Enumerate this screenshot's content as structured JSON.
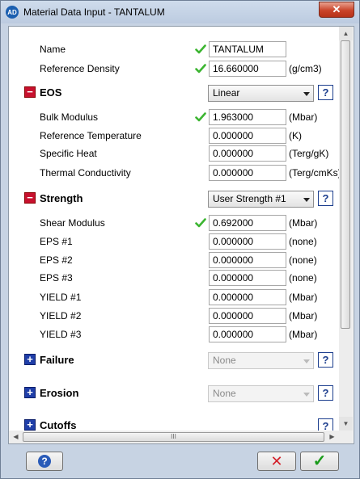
{
  "window": {
    "title": "Material Data Input - TANTALUM",
    "app_icon": "AD",
    "close_glyph": "✕"
  },
  "general": {
    "name_label": "Name",
    "name_value": "TANTALUM",
    "density_label": "Reference Density",
    "density_value": "16.660000",
    "density_unit": "(g/cm3)"
  },
  "eos": {
    "title": "EOS",
    "toggle": "−",
    "model": "Linear",
    "help": "?",
    "rows": [
      {
        "label": "Bulk Modulus",
        "value": "1.963000",
        "unit": "(Mbar)"
      },
      {
        "label": "Reference Temperature",
        "value": "0.000000",
        "unit": "(K)"
      },
      {
        "label": "Specific Heat",
        "value": "0.000000",
        "unit": "(Terg/gK)"
      },
      {
        "label": "Thermal Conductivity",
        "value": "0.000000",
        "unit": "(Terg/cmKs)"
      }
    ]
  },
  "strength": {
    "title": "Strength",
    "toggle": "−",
    "model": "User Strength #1",
    "help": "?",
    "rows": [
      {
        "label": "Shear Modulus",
        "value": "0.692000",
        "unit": "(Mbar)"
      },
      {
        "label": "EPS #1",
        "value": "0.000000",
        "unit": "(none)"
      },
      {
        "label": "EPS #2",
        "value": "0.000000",
        "unit": "(none)"
      },
      {
        "label": "EPS #3",
        "value": "0.000000",
        "unit": "(none)"
      },
      {
        "label": "YIELD #1",
        "value": "0.000000",
        "unit": "(Mbar)"
      },
      {
        "label": "YIELD #2",
        "value": "0.000000",
        "unit": "(Mbar)"
      },
      {
        "label": "YIELD #3",
        "value": "0.000000",
        "unit": "(Mbar)"
      }
    ]
  },
  "failure": {
    "title": "Failure",
    "toggle": "+",
    "model": "None",
    "help": "?"
  },
  "erosion": {
    "title": "Erosion",
    "toggle": "+",
    "model": "None",
    "help": "?"
  },
  "cutoffs": {
    "title": "Cutoffs",
    "toggle": "+",
    "help": "?"
  },
  "scroll": {
    "grip": "III",
    "up": "▲",
    "down": "▼",
    "left": "◀",
    "right": "▶"
  },
  "footer": {
    "help": "?",
    "cancel": "✕",
    "ok": "✓"
  },
  "colors": {
    "check": "#3cb531",
    "minus": "#c8102e",
    "plus": "#1f3ea8",
    "help": "#1c3e8e"
  }
}
